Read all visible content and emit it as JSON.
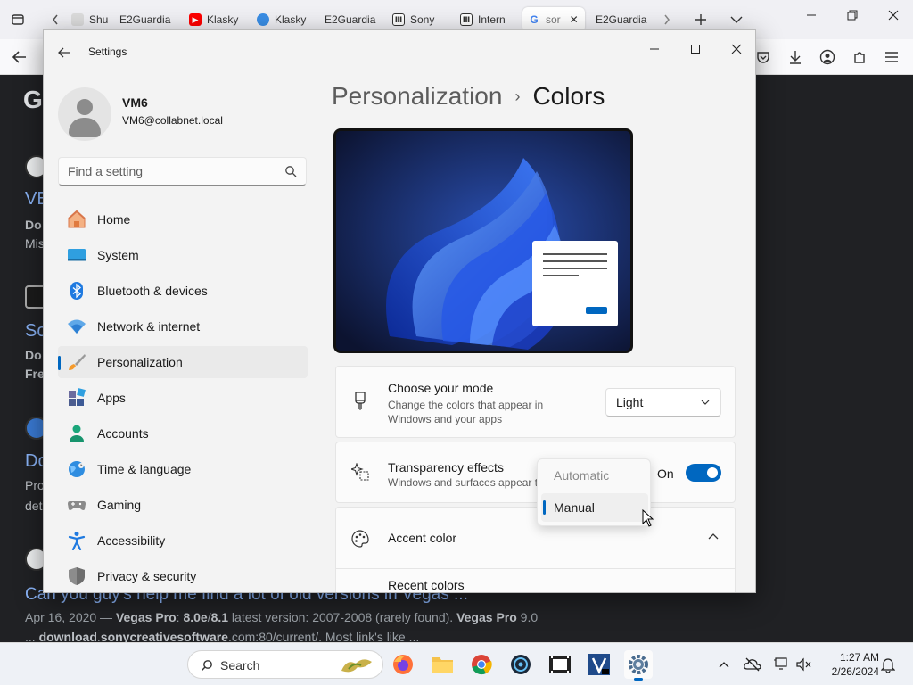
{
  "browser": {
    "tabs": [
      {
        "label": "Shuri",
        "icon": "page-icon"
      },
      {
        "label": "E2Guardia",
        "icon": "page-icon"
      },
      {
        "label": "Klasky",
        "icon": "youtube-icon"
      },
      {
        "label": "Klasky",
        "icon": "bird-icon"
      },
      {
        "label": "E2Guardia",
        "icon": "page-icon"
      },
      {
        "label": "Sony",
        "icon": "archive-icon"
      },
      {
        "label": "Intern",
        "icon": "archive-icon"
      },
      {
        "label": "sor",
        "icon": "google-icon",
        "active": true
      },
      {
        "label": "E2Guardia",
        "icon": "page-icon"
      }
    ]
  },
  "page": {
    "logo": "G",
    "fragments": [
      "V",
      "VE",
      "Do",
      "Mis",
      "V",
      "So",
      "Do",
      "Fre",
      "Do",
      "Pro",
      "det",
      "V"
    ],
    "result_title": "Can you guy's help me find a lot of old versions in Vegas ...",
    "snippet_line1_prefix": "Apr 16, 2020 — ",
    "snippet_line1_b1": "Vegas Pro",
    "snippet_line1_mid1": ": ",
    "snippet_line1_b2": "8.0e",
    "snippet_line1_mid2": "/",
    "snippet_line1_b3": "8.1",
    "snippet_line1_mid3": " latest version: 2007-2008 (rarely found). ",
    "snippet_line1_b4": "Vegas Pro",
    "snippet_line1_suffix": " 9.0",
    "snippet_line2_prefix": "... ",
    "snippet_line2_b1": "download",
    "snippet_line2_mid1": ".",
    "snippet_line2_b2": "sonycreativesoftware",
    "snippet_line2_suffix": ".com:80/current/. Most link's like ..."
  },
  "settings": {
    "app_title": "Settings",
    "user": {
      "name": "VM6",
      "email": "VM6@collabnet.local"
    },
    "search_placeholder": "Find a setting",
    "nav": [
      {
        "label": "Home",
        "icon": "home-icon"
      },
      {
        "label": "System",
        "icon": "system-icon"
      },
      {
        "label": "Bluetooth & devices",
        "icon": "bluetooth-icon"
      },
      {
        "label": "Network & internet",
        "icon": "network-icon"
      },
      {
        "label": "Personalization",
        "icon": "brush-icon",
        "selected": true
      },
      {
        "label": "Apps",
        "icon": "apps-icon"
      },
      {
        "label": "Accounts",
        "icon": "accounts-icon"
      },
      {
        "label": "Time & language",
        "icon": "globe-icon"
      },
      {
        "label": "Gaming",
        "icon": "gamepad-icon"
      },
      {
        "label": "Accessibility",
        "icon": "accessibility-icon"
      },
      {
        "label": "Privacy & security",
        "icon": "shield-icon"
      }
    ],
    "breadcrumb": {
      "parent": "Personalization",
      "separator": "›",
      "current": "Colors"
    },
    "mode_card": {
      "title": "Choose your mode",
      "subtitle_line1": "Change the colors that appear in",
      "subtitle_line2": "Windows and your apps",
      "value": "Light"
    },
    "transparency_card": {
      "title": "Transparency effects",
      "subtitle": "Windows and surfaces appear translucent",
      "state_label": "On",
      "enabled": true
    },
    "accent_card": {
      "title": "Accent color"
    },
    "recent_colors_label": "Recent colors",
    "accent_dropdown": {
      "options": [
        "Automatic",
        "Manual"
      ],
      "selected": "Manual"
    }
  },
  "taskbar": {
    "search_label": "Search",
    "time": "1:27 AM",
    "date": "2/26/2024"
  },
  "colors": {
    "accent": "#0067c0",
    "window_bg": "#f3f3f3",
    "page_bg": "#202124"
  }
}
